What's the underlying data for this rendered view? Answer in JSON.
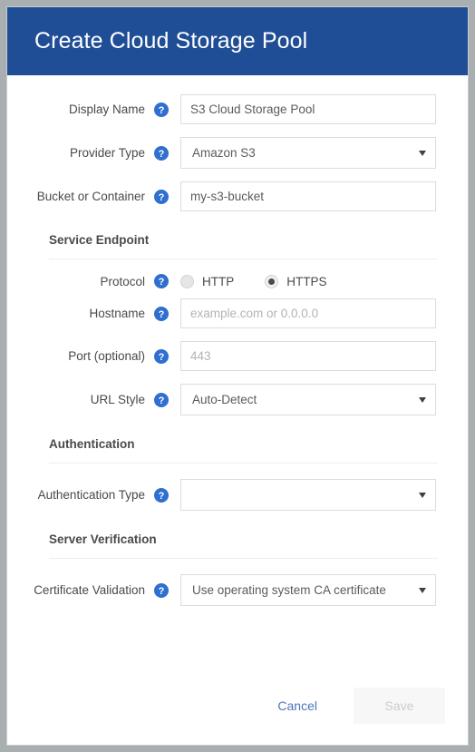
{
  "dialog": {
    "title": "Create Cloud Storage Pool",
    "header_color": "#1f4e96",
    "help_icon_color": "#2f6fd0"
  },
  "fields": {
    "display_name": {
      "label": "Display Name",
      "help_icon": "help-circle-icon",
      "value": "S3 Cloud Storage Pool",
      "placeholder": ""
    },
    "provider_type": {
      "label": "Provider Type",
      "help_icon": "help-circle-icon",
      "value": "Amazon S3"
    },
    "bucket_or_container": {
      "label": "Bucket or Container",
      "help_icon": "help-circle-icon",
      "value": "my-s3-bucket",
      "placeholder": ""
    },
    "protocol": {
      "label": "Protocol",
      "help_icon": "help-circle-icon",
      "options": [
        {
          "label": "HTTP",
          "selected": false
        },
        {
          "label": "HTTPS",
          "selected": true
        }
      ]
    },
    "hostname": {
      "label": "Hostname",
      "help_icon": "help-circle-icon",
      "value": "",
      "placeholder": "example.com or 0.0.0.0"
    },
    "port": {
      "label": "Port (optional)",
      "help_icon": "help-circle-icon",
      "value": "",
      "placeholder": "443"
    },
    "url_style": {
      "label": "URL Style",
      "help_icon": "help-circle-icon",
      "value": "Auto-Detect"
    },
    "authentication_type": {
      "label": "Authentication Type",
      "help_icon": "help-circle-icon",
      "value": ""
    },
    "certificate_validation": {
      "label": "Certificate Validation",
      "help_icon": "help-circle-icon",
      "value": "Use operating system CA certificate"
    }
  },
  "sections": {
    "service_endpoint": {
      "title": "Service Endpoint"
    },
    "authentication": {
      "title": "Authentication"
    },
    "server_verification": {
      "title": "Server Verification"
    }
  },
  "footer": {
    "cancel_label": "Cancel",
    "save_label": "Save",
    "save_disabled": true
  }
}
